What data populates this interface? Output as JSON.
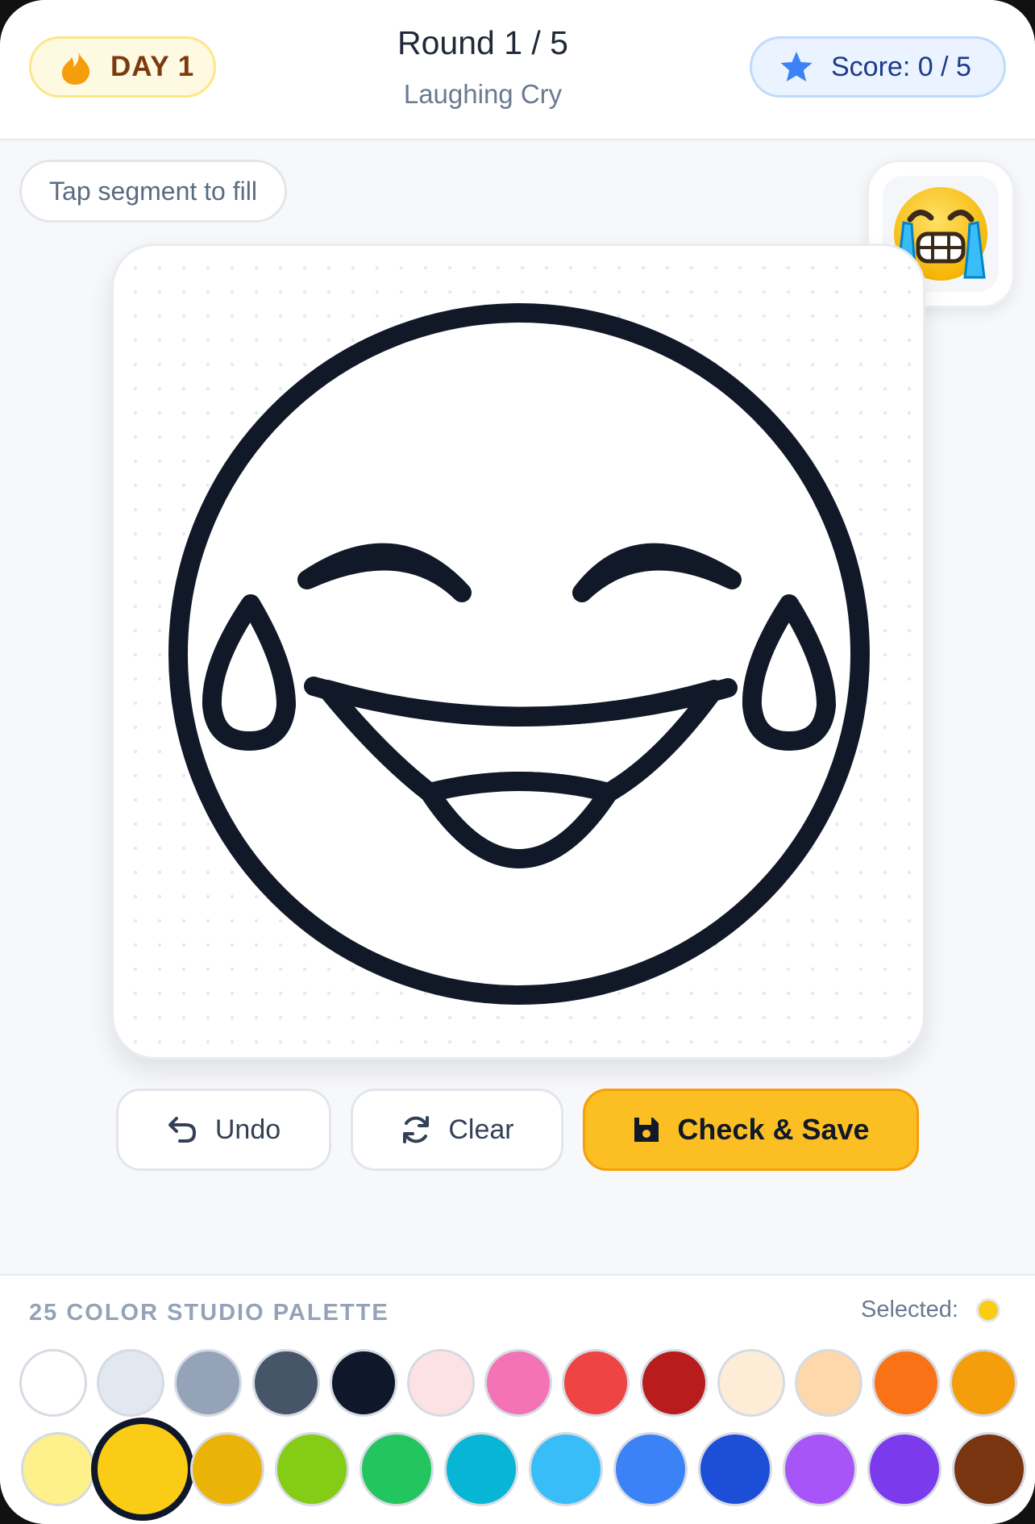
{
  "header": {
    "day_label": "DAY 1",
    "round_label": "Round 1 / 5",
    "emoji_name": "Laughing Cry",
    "score_label": "Score: 0 / 5"
  },
  "hint": "Tap segment to fill",
  "reference": {
    "emoji": "😭"
  },
  "actions": {
    "undo_label": "Undo",
    "clear_label": "Clear",
    "save_label": "Check & Save"
  },
  "palette": {
    "title": "25 COLOR STUDIO PALETTE",
    "selected_label": "Selected:",
    "selected_color": "#facc15",
    "colors": [
      "#ffffff",
      "#e2e8f0",
      "#94a3b8",
      "#475569",
      "#0f172a",
      "#fde2e4",
      "#f472b6",
      "#ef4444",
      "#b91c1c",
      "#feedd6",
      "#fed7aa",
      "#f97316",
      "#f59e0b",
      "#fef08a",
      "#facc15",
      "#eab308",
      "#84cc16",
      "#22c55e",
      "#06b6d4",
      "#38bdf8",
      "#3b82f6",
      "#1d4ed8",
      "#a855f7",
      "#7c3aed",
      "#78350f"
    ],
    "selected_index": 14
  },
  "colors": {
    "accent": "#fbbf24",
    "outline": "#111827"
  }
}
